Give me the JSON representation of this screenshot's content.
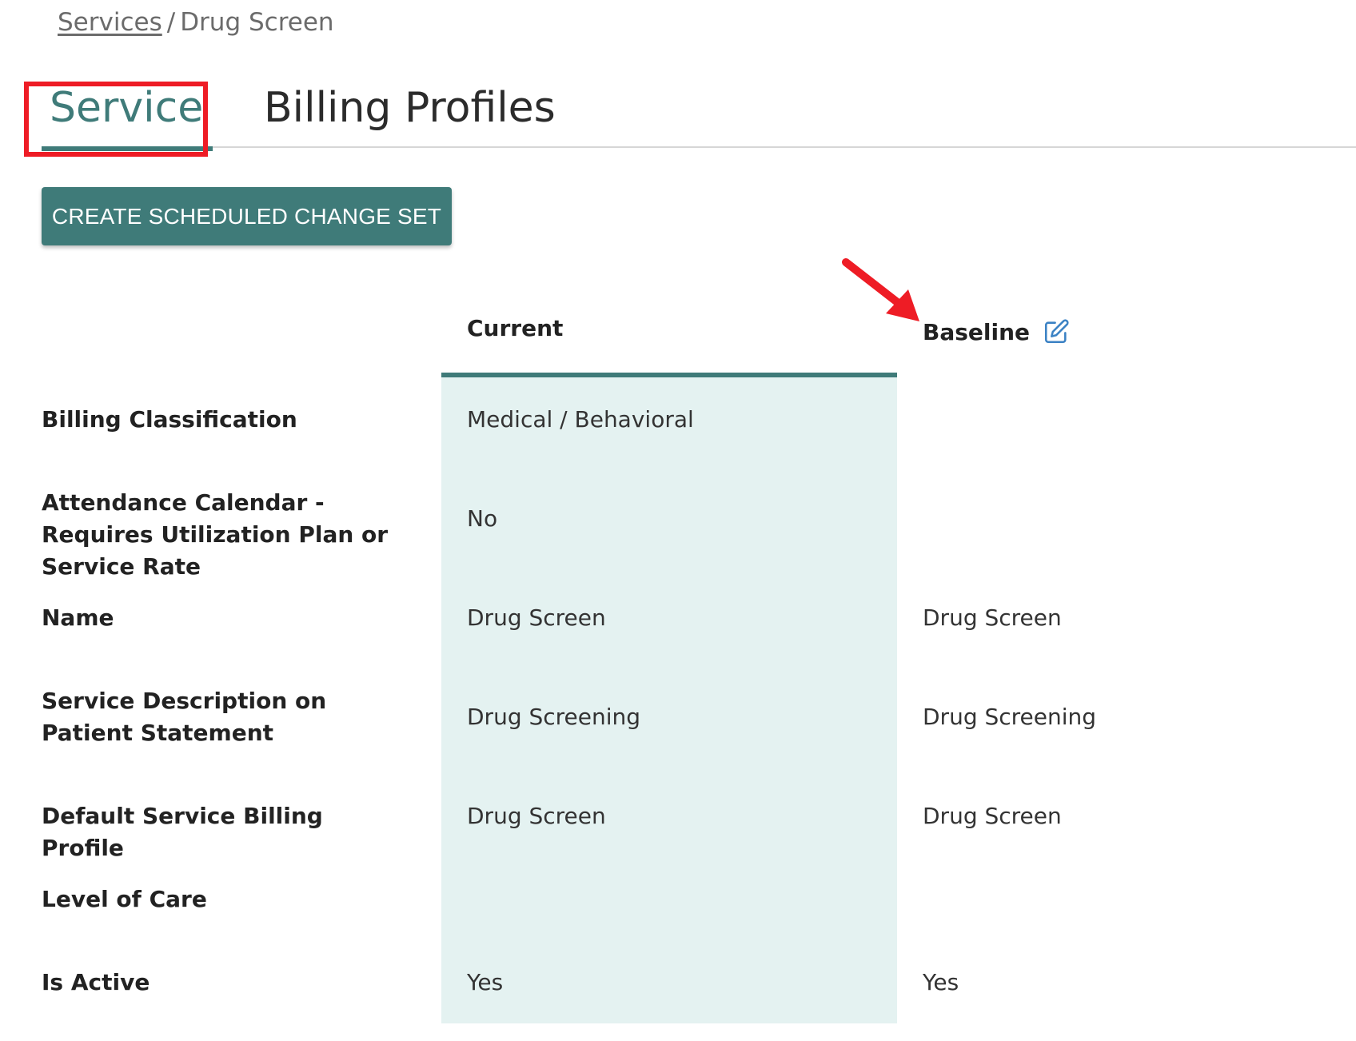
{
  "breadcrumb": {
    "link": "Services",
    "separator": "/",
    "current": "Drug Screen"
  },
  "tabs": [
    {
      "label": "Service",
      "active": true
    },
    {
      "label": "Billing Profiles",
      "active": false
    }
  ],
  "actions": {
    "create_button": "CREATE SCHEDULED CHANGE SET"
  },
  "table": {
    "headers": {
      "current": "Current",
      "baseline": "Baseline"
    },
    "rows": [
      {
        "label": "Billing Classification",
        "current": "Medical / Behavioral",
        "baseline": ""
      },
      {
        "label": "Attendance Calendar - Requires Utilization Plan or Service Rate",
        "current": "No",
        "baseline": ""
      },
      {
        "label": "Name",
        "current": "Drug Screen",
        "baseline": "Drug Screen"
      },
      {
        "label": "Service Description on Patient Statement",
        "current": "Drug Screening",
        "baseline": "Drug Screening"
      },
      {
        "label": "Default Service Billing Profile",
        "current": "Drug Screen",
        "baseline": "Drug Screen"
      },
      {
        "label": "Level of Care",
        "current": "",
        "baseline": ""
      },
      {
        "label": "Is Active",
        "current": "Yes",
        "baseline": "Yes"
      }
    ]
  },
  "icons": {
    "baseline_edit": "edit-icon",
    "annotation": "arrow-icon"
  },
  "colors": {
    "accent": "#3f7b79",
    "current_column_bg": "#e4f2f1",
    "annotation_red": "#ee1c25",
    "edit_icon_blue": "#3b82c4"
  }
}
